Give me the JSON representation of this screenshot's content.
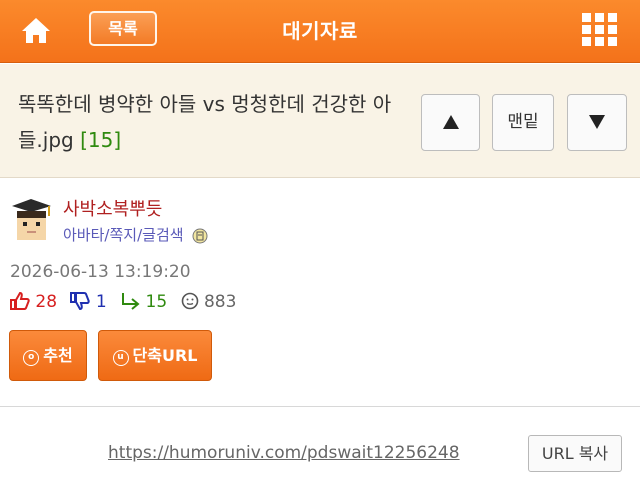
{
  "header": {
    "list_label": "목록",
    "title": "대기자료",
    "icons": {
      "home": "home-icon",
      "menu": "grid-menu-icon"
    },
    "colors": {
      "bar": "#f4721a"
    }
  },
  "post": {
    "title": "똑똑한데 병약한 아들 vs 멍청한데 건강한 아들.jpg",
    "reply_count": "[15]",
    "nav": {
      "up_icon": "arrow-up-icon",
      "bottom_label": "맨밑",
      "down_icon": "arrow-down-icon"
    }
  },
  "author": {
    "name": "사박소복뿌듯",
    "links": [
      "아바타",
      "쪽지",
      "글검색"
    ],
    "separator": "/",
    "avatar_icon": "graduate-avatar-icon",
    "badge_icon": "search-badge-icon"
  },
  "meta": {
    "date": "2026-06-13 13:19:20",
    "likes": "28",
    "dislikes": "1",
    "replies": "15",
    "views": "883"
  },
  "actions": {
    "recommend_label": "추천",
    "shorturl_label": "단축URL"
  },
  "share": {
    "url": "https://humoruniv.com/pdswait12256248",
    "copy_label": "URL 복사"
  }
}
